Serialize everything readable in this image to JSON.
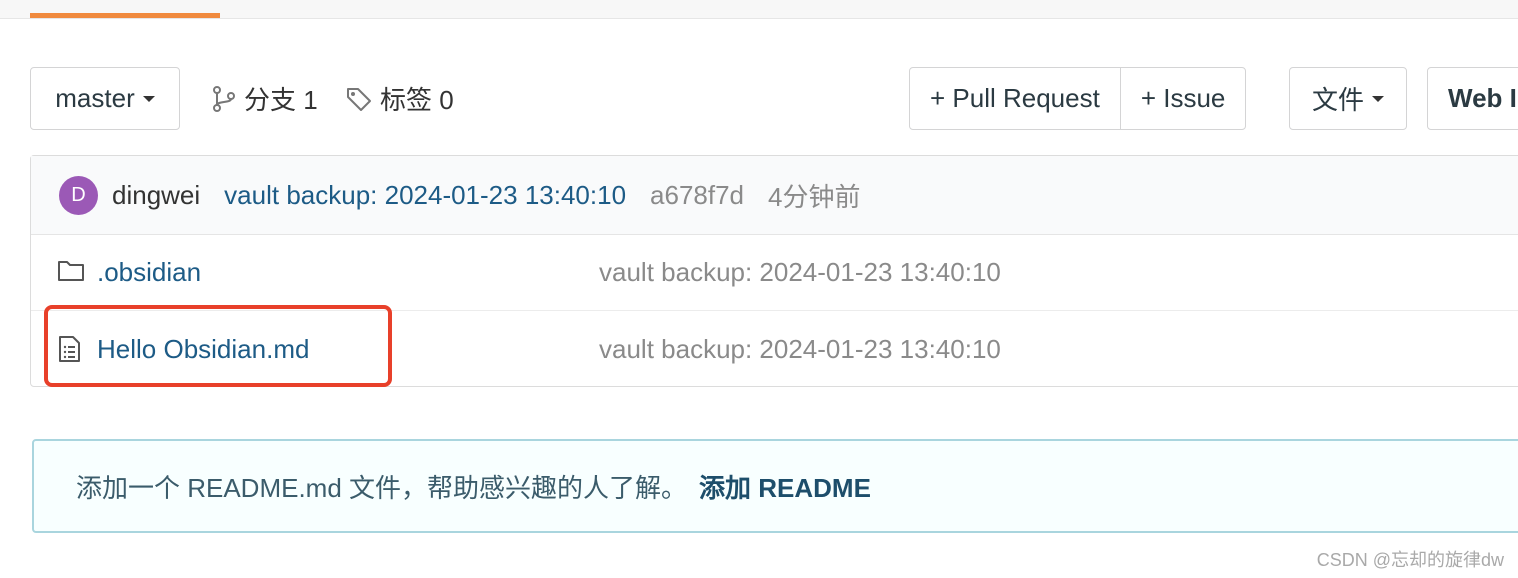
{
  "tabs": {
    "active_indicator_color": "#f08a3e"
  },
  "branch": {
    "selected": "master",
    "icon": "chevron-down-icon"
  },
  "meta": {
    "branches_label": "分支 1",
    "tags_label": "标签 0",
    "branch_icon": "git-branch-icon",
    "tag_icon": "tag-icon"
  },
  "actions": {
    "pull_request": "+ Pull Request",
    "issue": "+ Issue",
    "file_menu": "文件",
    "web_ide": "Web IDE"
  },
  "commit": {
    "avatar_letter": "D",
    "avatar_color": "#9b59b6",
    "author": "dingwei",
    "message": "vault backup: 2024-01-23 13:40:10",
    "sha": "a678f7d",
    "time": "4分钟前"
  },
  "files": [
    {
      "name": ".obsidian",
      "type": "folder",
      "icon": "folder-icon",
      "message": "vault backup: 2024-01-23 13:40:10"
    },
    {
      "name": "Hello Obsidian.md",
      "type": "file",
      "icon": "file-text-icon",
      "message": "vault backup: 2024-01-23 13:40:10"
    }
  ],
  "readme": {
    "text": "添加一个 README.md 文件，帮助感兴趣的人了解。",
    "link": "添加 README"
  },
  "watermark": "CSDN @忘却的旋律dw",
  "colors": {
    "highlight": "#e8402a",
    "link": "#1d5b86"
  }
}
